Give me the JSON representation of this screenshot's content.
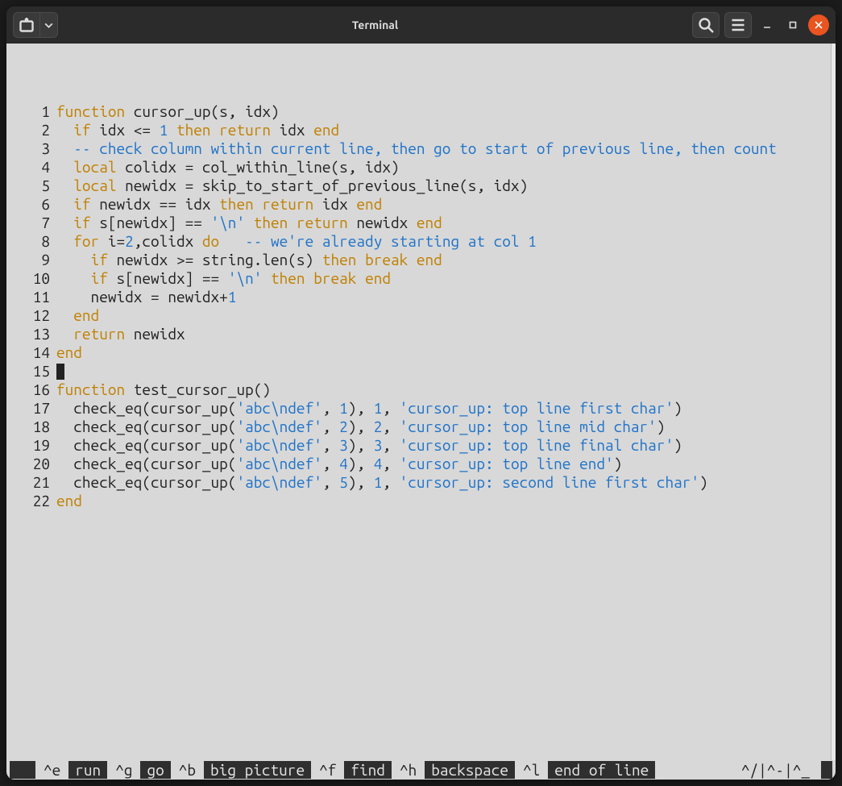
{
  "window": {
    "title": "Terminal"
  },
  "colors": {
    "keyword": "#c08000",
    "blue": "#1f73c9",
    "editor_bg": "#d8d8d8"
  },
  "lines": [
    {
      "n": "1",
      "segs": [
        [
          "kw",
          "function"
        ],
        [
          "",
          " cursor_up(s, idx)"
        ]
      ]
    },
    {
      "n": "2",
      "segs": [
        [
          "",
          "  "
        ],
        [
          "kw",
          "if"
        ],
        [
          "",
          " idx <= "
        ],
        [
          "num",
          "1"
        ],
        [
          "",
          " "
        ],
        [
          "kw",
          "then"
        ],
        [
          "",
          " "
        ],
        [
          "kw",
          "return"
        ],
        [
          "",
          " idx "
        ],
        [
          "kw",
          "end"
        ]
      ]
    },
    {
      "n": "3",
      "segs": [
        [
          "",
          "  "
        ],
        [
          "com",
          "-- check column within current line, then go to start of previous line, then count"
        ]
      ]
    },
    {
      "n": "4",
      "segs": [
        [
          "",
          "  "
        ],
        [
          "kw",
          "local"
        ],
        [
          "",
          " colidx = col_within_line(s, idx)"
        ]
      ]
    },
    {
      "n": "5",
      "segs": [
        [
          "",
          "  "
        ],
        [
          "kw",
          "local"
        ],
        [
          "",
          " newidx = skip_to_start_of_previous_line(s, idx)"
        ]
      ]
    },
    {
      "n": "6",
      "segs": [
        [
          "",
          "  "
        ],
        [
          "kw",
          "if"
        ],
        [
          "",
          " newidx == idx "
        ],
        [
          "kw",
          "then"
        ],
        [
          "",
          " "
        ],
        [
          "kw",
          "return"
        ],
        [
          "",
          " idx "
        ],
        [
          "kw",
          "end"
        ]
      ]
    },
    {
      "n": "7",
      "segs": [
        [
          "",
          "  "
        ],
        [
          "kw",
          "if"
        ],
        [
          "",
          " s[newidx] == "
        ],
        [
          "str",
          "'\\n'"
        ],
        [
          "",
          " "
        ],
        [
          "kw",
          "then"
        ],
        [
          "",
          " "
        ],
        [
          "kw",
          "return"
        ],
        [
          "",
          " newidx "
        ],
        [
          "kw",
          "end"
        ]
      ]
    },
    {
      "n": "8",
      "segs": [
        [
          "",
          "  "
        ],
        [
          "kw",
          "for"
        ],
        [
          "",
          " i="
        ],
        [
          "num",
          "2"
        ],
        [
          "",
          ",colidx "
        ],
        [
          "kw",
          "do"
        ],
        [
          "",
          "   "
        ],
        [
          "com",
          "-- we're already starting at col 1"
        ]
      ]
    },
    {
      "n": "9",
      "segs": [
        [
          "",
          "    "
        ],
        [
          "kw",
          "if"
        ],
        [
          "",
          " newidx >= string.len(s) "
        ],
        [
          "kw",
          "then"
        ],
        [
          "",
          " "
        ],
        [
          "kw",
          "break"
        ],
        [
          "",
          " "
        ],
        [
          "kw",
          "end"
        ]
      ]
    },
    {
      "n": "10",
      "segs": [
        [
          "",
          "    "
        ],
        [
          "kw",
          "if"
        ],
        [
          "",
          " s[newidx] == "
        ],
        [
          "str",
          "'\\n'"
        ],
        [
          "",
          " "
        ],
        [
          "kw",
          "then"
        ],
        [
          "",
          " "
        ],
        [
          "kw",
          "break"
        ],
        [
          "",
          " "
        ],
        [
          "kw",
          "end"
        ]
      ]
    },
    {
      "n": "11",
      "segs": [
        [
          "",
          "    newidx = newidx+"
        ],
        [
          "num",
          "1"
        ]
      ]
    },
    {
      "n": "12",
      "segs": [
        [
          "",
          "  "
        ],
        [
          "kw",
          "end"
        ]
      ]
    },
    {
      "n": "13",
      "segs": [
        [
          "",
          "  "
        ],
        [
          "kw",
          "return"
        ],
        [
          "",
          " newidx"
        ]
      ]
    },
    {
      "n": "14",
      "segs": [
        [
          "kw",
          "end"
        ]
      ]
    },
    {
      "n": "15",
      "cursor": true,
      "segs": []
    },
    {
      "n": "16",
      "segs": [
        [
          "kw",
          "function"
        ],
        [
          "",
          " test_cursor_up()"
        ]
      ]
    },
    {
      "n": "17",
      "segs": [
        [
          "",
          "  check_eq(cursor_up("
        ],
        [
          "str",
          "'abc\\ndef'"
        ],
        [
          "",
          ", "
        ],
        [
          "num",
          "1"
        ],
        [
          "",
          "), "
        ],
        [
          "num",
          "1"
        ],
        [
          "",
          ", "
        ],
        [
          "str",
          "'cursor_up: top line first char'"
        ],
        [
          "",
          ")"
        ]
      ]
    },
    {
      "n": "18",
      "segs": [
        [
          "",
          "  check_eq(cursor_up("
        ],
        [
          "str",
          "'abc\\ndef'"
        ],
        [
          "",
          ", "
        ],
        [
          "num",
          "2"
        ],
        [
          "",
          "), "
        ],
        [
          "num",
          "2"
        ],
        [
          "",
          ", "
        ],
        [
          "str",
          "'cursor_up: top line mid char'"
        ],
        [
          "",
          ")"
        ]
      ]
    },
    {
      "n": "19",
      "segs": [
        [
          "",
          "  check_eq(cursor_up("
        ],
        [
          "str",
          "'abc\\ndef'"
        ],
        [
          "",
          ", "
        ],
        [
          "num",
          "3"
        ],
        [
          "",
          "), "
        ],
        [
          "num",
          "3"
        ],
        [
          "",
          ", "
        ],
        [
          "str",
          "'cursor_up: top line final char'"
        ],
        [
          "",
          ")"
        ]
      ]
    },
    {
      "n": "20",
      "segs": [
        [
          "",
          "  check_eq(cursor_up("
        ],
        [
          "str",
          "'abc\\ndef'"
        ],
        [
          "",
          ", "
        ],
        [
          "num",
          "4"
        ],
        [
          "",
          "), "
        ],
        [
          "num",
          "4"
        ],
        [
          "",
          ", "
        ],
        [
          "str",
          "'cursor_up: top line end'"
        ],
        [
          "",
          ")"
        ]
      ]
    },
    {
      "n": "21",
      "segs": [
        [
          "",
          "  check_eq(cursor_up("
        ],
        [
          "str",
          "'abc\\ndef'"
        ],
        [
          "",
          ", "
        ],
        [
          "num",
          "5"
        ],
        [
          "",
          "), "
        ],
        [
          "num",
          "1"
        ],
        [
          "",
          ", "
        ],
        [
          "str",
          "'cursor_up: second line first char'"
        ],
        [
          "",
          ")"
        ]
      ]
    },
    {
      "n": "22",
      "segs": [
        [
          "kw",
          "end"
        ]
      ]
    }
  ],
  "footer": {
    "items": [
      {
        "key": "^e",
        "action": "run"
      },
      {
        "key": "^g",
        "action": "go"
      },
      {
        "key": "^b",
        "action": "big picture"
      },
      {
        "key": "^f",
        "action": "find"
      },
      {
        "key": "^h",
        "action": "backspace"
      },
      {
        "key": "^l",
        "action": "end of line"
      }
    ],
    "tail": "^/|^-|^_"
  }
}
